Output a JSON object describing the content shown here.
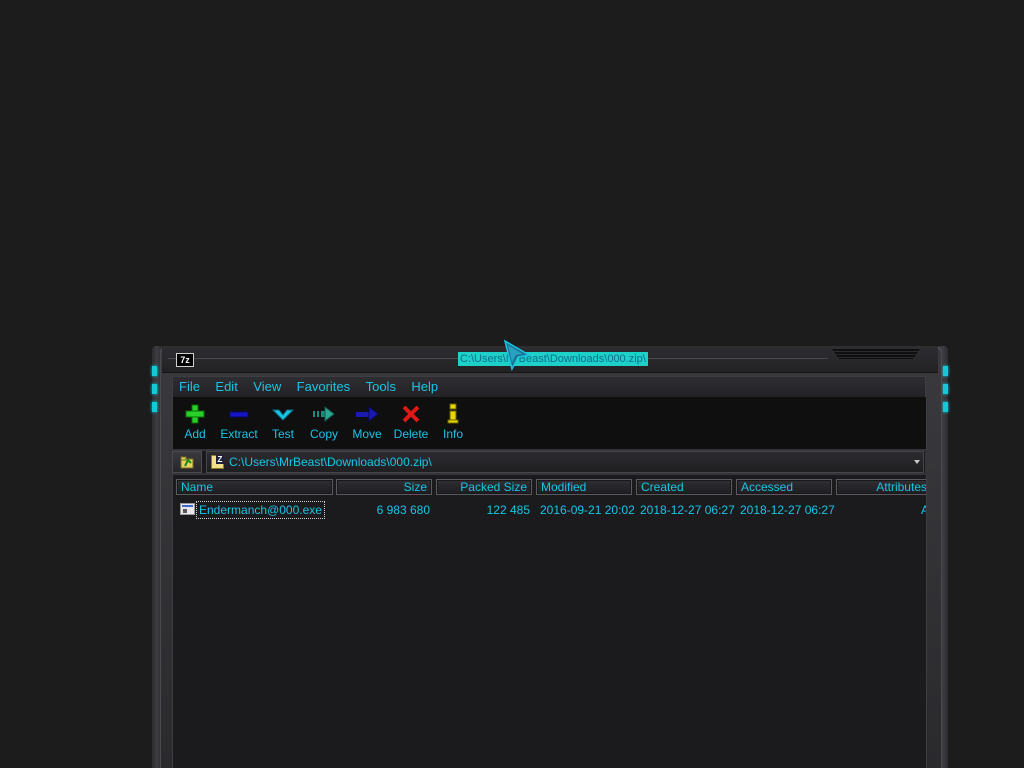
{
  "window": {
    "title": "C:\\Users\\MrBeast\\Downloads\\000.zip\\",
    "logo_text": "7z"
  },
  "menu": {
    "items": [
      "File",
      "Edit",
      "View",
      "Favorites",
      "Tools",
      "Help"
    ]
  },
  "toolbar": {
    "buttons": [
      {
        "label": "Add",
        "icon": "add-icon"
      },
      {
        "label": "Extract",
        "icon": "extract-icon"
      },
      {
        "label": "Test",
        "icon": "test-icon"
      },
      {
        "label": "Copy",
        "icon": "copy-icon"
      },
      {
        "label": "Move",
        "icon": "move-icon"
      },
      {
        "label": "Delete",
        "icon": "delete-icon"
      },
      {
        "label": "Info",
        "icon": "info-icon"
      }
    ]
  },
  "address": {
    "path": "C:\\Users\\MrBeast\\Downloads\\000.zip\\"
  },
  "file_list": {
    "columns": [
      "Name",
      "Size",
      "Packed Size",
      "Modified",
      "Created",
      "Accessed",
      "Attributes"
    ],
    "rows": [
      {
        "name": "Endermanch@000.exe",
        "size": "6 983 680",
        "packed_size": "122 485",
        "modified": "2016-09-21 20:02",
        "created": "2018-12-27 06:27",
        "accessed": "2018-12-27 06:27",
        "attributes": "A"
      }
    ]
  },
  "colors": {
    "accent_text": "#19c5e5",
    "background": "#1c1c1c",
    "title_highlight": "#1dd0c8"
  }
}
